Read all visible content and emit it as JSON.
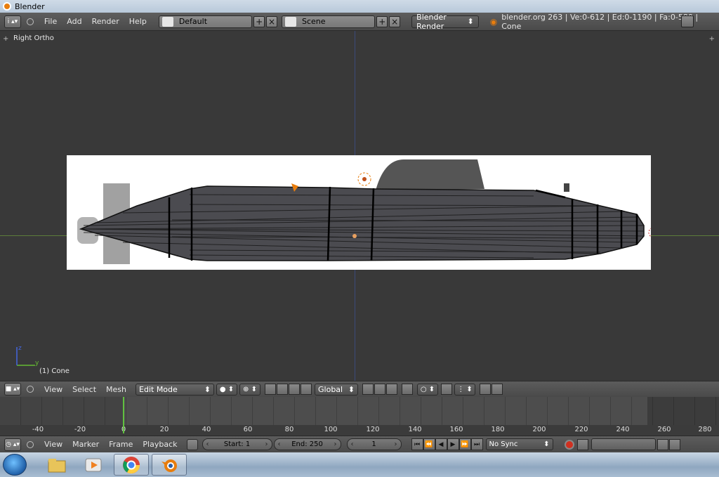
{
  "window": {
    "title": "Blender"
  },
  "info_header": {
    "menus": [
      "File",
      "Add",
      "Render",
      "Help"
    ],
    "screen_layout": "Default",
    "scene": "Scene",
    "render_engine": "Blender Render",
    "stats": "blender.org 263 | Ve:0-612 | Ed:0-1190 | Fa:0-580 | Cone"
  },
  "viewport": {
    "view_label": "Right Ortho",
    "object_label": "(1) Cone"
  },
  "view3d_header": {
    "menus": [
      "View",
      "Select",
      "Mesh"
    ],
    "mode": "Edit Mode",
    "orientation": "Global"
  },
  "timeline": {
    "ticks": [
      "-40",
      "-20",
      "0",
      "20",
      "40",
      "60",
      "80",
      "100",
      "120",
      "140",
      "160",
      "180",
      "200",
      "220",
      "240",
      "260",
      "280"
    ],
    "menus": [
      "View",
      "Marker",
      "Frame",
      "Playback"
    ],
    "start_label": "Start: 1",
    "end_label": "End: 250",
    "current_frame": "1",
    "sync": "No Sync"
  },
  "colors": {
    "accent": "#e87d0d",
    "x_axis": "#5c7d3a",
    "y_axis": "#3c4a7a",
    "frame_cursor": "#60c040"
  }
}
